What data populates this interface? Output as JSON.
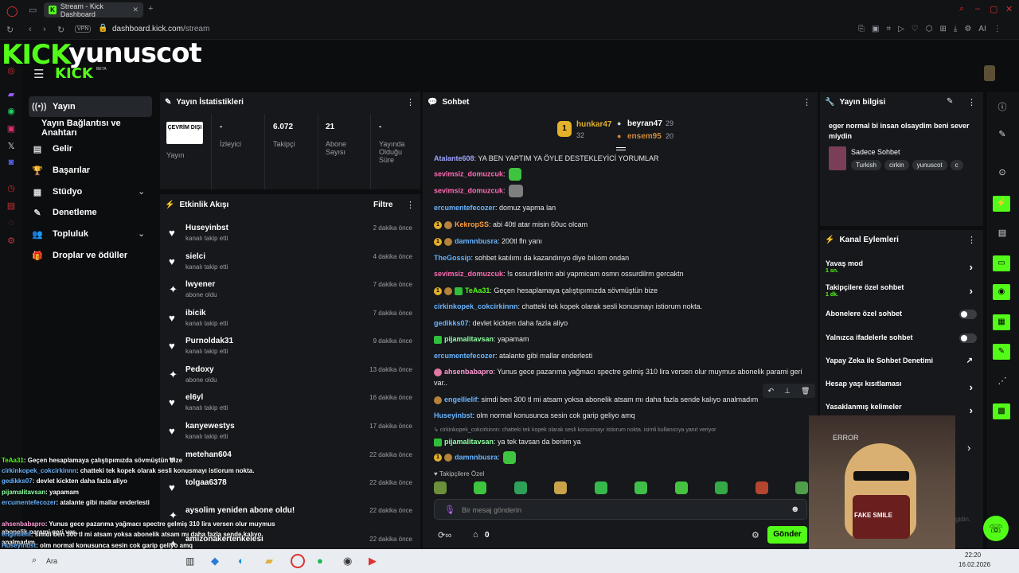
{
  "browser": {
    "tab_title": "Stream - Kick Dashboard",
    "url_domain": "dashboard.kick.com",
    "url_path": "/stream",
    "vpn": "VPN",
    "ai": "AI"
  },
  "brand": {
    "logo": "KICK",
    "channel": "yunuscot",
    "small_logo": "KICK",
    "beta": "BETA"
  },
  "nav": {
    "items": [
      {
        "label": "Yayın",
        "icon": "((•))"
      },
      {
        "label": "Yayın Bağlantısı ve Anahtarı"
      },
      {
        "label": "Gelir",
        "icon": "▤"
      },
      {
        "label": "Başarılar",
        "icon": "🏆"
      },
      {
        "label": "Stüdyo",
        "icon": "▦"
      },
      {
        "label": "Denetleme",
        "icon": "✎"
      },
      {
        "label": "Topluluk",
        "icon": "👥"
      },
      {
        "label": "Droplar ve ödüller",
        "icon": "🎁"
      }
    ]
  },
  "stats": {
    "title": "Yayın İstatistikleri",
    "badge": "ÇEVRİM DIŞI",
    "items": [
      {
        "value": "",
        "label": "Yayın"
      },
      {
        "value": "-",
        "label": "İzleyici"
      },
      {
        "value": "6.072",
        "label": "Takipçi"
      },
      {
        "value": "21",
        "label": "Abone Sayısı"
      },
      {
        "value": "-",
        "label": "Yayında Olduğu Süre"
      }
    ]
  },
  "activity": {
    "title": "Etkinlik Akışı",
    "filter": "Filtre",
    "rows": [
      {
        "name": "Huseyinbst",
        "sub": "kanalı takip etti",
        "time": "2 dakika önce",
        "icon": "♥"
      },
      {
        "name": "sielci",
        "sub": "kanalı takip etti",
        "time": "4 dakika önce",
        "icon": "♥"
      },
      {
        "name": "lwyener",
        "sub": "abone oldu",
        "time": "7 dakika önce",
        "icon": "✦"
      },
      {
        "name": "ibicik",
        "sub": "kanalı takip etti",
        "time": "7 dakika önce",
        "icon": "♥"
      },
      {
        "name": "Purnoldak31",
        "sub": "kanalı takip etti",
        "time": "9 dakika önce",
        "icon": "♥"
      },
      {
        "name": "Pedoxy",
        "sub": "abone oldu",
        "time": "13 dakika önce",
        "icon": "✦"
      },
      {
        "name": "el6yl",
        "sub": "kanalı takip etti",
        "time": "16 dakika önce",
        "icon": "♥"
      },
      {
        "name": "kanyewestys",
        "sub": "kanalı takip etti",
        "time": "17 dakika önce",
        "icon": "♥"
      },
      {
        "name": "metehan604",
        "sub": "",
        "time": "22 dakika önce",
        "icon": "♥"
      },
      {
        "name": "tolgaa6378",
        "sub": "",
        "time": "22 dakika önce",
        "icon": "♥"
      },
      {
        "name": "aysolim yeniden abone oldu!",
        "sub": "",
        "time": "22 dakika önce",
        "icon": "✦"
      },
      {
        "name": "amizonakertenkelesi",
        "sub": "",
        "time": "22 dakika önce",
        "icon": "✦"
      }
    ]
  },
  "chat": {
    "title": "Sohbet",
    "leaders": [
      {
        "rank": "1",
        "name": "hunkar47",
        "count": "32"
      },
      {
        "rank": "",
        "name": "beyran47",
        "count": "29"
      },
      {
        "rank": "",
        "name": "ensem95",
        "count": "20"
      }
    ],
    "messages": [
      {
        "user": "Atalante608",
        "color": "#9ea3ff",
        "text": ": YA BEN YAPTIM YA ÖYLE DESTEKLEYİCİ YORUMLAR",
        "badges": []
      },
      {
        "user": "sevimsiz_domuzcuk",
        "color": "#ff6bb5",
        "text": ":",
        "badges": [],
        "emote": "green"
      },
      {
        "user": "sevimsiz_domuzcuk",
        "color": "#ff6bb5",
        "text": ":",
        "badges": [],
        "emote": "gray"
      },
      {
        "user": "ercumentefecozer",
        "color": "#69b4ff",
        "text": ": domuz yapma lan",
        "badges": []
      },
      {
        "user": "KekropSS",
        "color": "#ff9a3c",
        "text": ": abi 40tl atar misin 60uc olcam",
        "badges": [
          "gold",
          "bronze"
        ]
      },
      {
        "user": "damnnbusra",
        "color": "#69b4ff",
        "text": ": 200tl fln yanı",
        "badges": [
          "gold",
          "bronze"
        ]
      },
      {
        "user": "TheGossip",
        "color": "#5fb0ff",
        "text": ": sohbet katılımı da kazandırıyo diye bılıom ondan",
        "badges": []
      },
      {
        "user": "sevimsiz_domuzcuk",
        "color": "#ff6bb5",
        "text": ": !s ossurdilerim abi yapmicam osmn ossurdilrm gercaktn",
        "badges": []
      },
      {
        "user": "TeAa31",
        "color": "#53fc18",
        "text": ": Geçen hesaplamaya çalıştıpımızda sövmüştün bize",
        "badges": [
          "gold",
          "bronze",
          "green"
        ]
      },
      {
        "user": "cirkinkopek_cokcirkinnn",
        "color": "#69b4ff",
        "text": ": chatteki tek kopek olarak sesli konusmayı istiorum nokta.",
        "badges": []
      },
      {
        "user": "gedikks07",
        "color": "#69b4ff",
        "text": ": devlet kickten daha fazla aliyo",
        "badges": []
      },
      {
        "user": "pijamalitavsan",
        "color": "#8effa0",
        "text": ": yapamam",
        "badges": [
          "green"
        ]
      },
      {
        "user": "ercumentefecozer",
        "color": "#69b4ff",
        "text": ": atalante gibi mallar enderlesti",
        "badges": []
      },
      {
        "user": "ahsenbabapro",
        "color": "#ff9ad5",
        "text": ": Yunus gece pazarıma yağmacı spectre gelmiş 310 lira versen olur muymus abonelik parami geri var..",
        "badges": [
          "pink"
        ]
      },
      {
        "user": "engellielif",
        "color": "#69b4ff",
        "text": ": simdi ben 300 tl mi atsam yoksa abonelik atsam mı daha fazla sende kalıyo analmadım",
        "badges": [
          "bronze"
        ]
      },
      {
        "user": "Huseyinbst",
        "color": "#69b4ff",
        "text": ": olm normal konusunca sesin cok garip geliyo amq",
        "badges": []
      },
      {
        "user": "pijamalitavsan",
        "color": "#8effa0",
        "text": ": ya tek tavsan da benim ya",
        "badges": [
          "green"
        ],
        "reply": "cirkinkopek_cokcirkinnn: chatteki tek kopek olarak sesli konusmayı istiorum nokta. isimli kullanıcıya yanıt veriyor"
      },
      {
        "user": "damnnbusra",
        "color": "#69b4ff",
        "text": ":",
        "badges": [
          "gold",
          "bronze"
        ],
        "emote": "green"
      }
    ],
    "followers_only": "Takipçilere Özel",
    "input_placeholder": "Bir mesaj gönderin",
    "points": "0",
    "send": "Gönder"
  },
  "info": {
    "title": "Yayın bilgisi",
    "stream_title": "eger normal bi insan olsaydim beni sever miydin",
    "category": "Sadece Sohbet",
    "tags": [
      "Turkish",
      "cirkin",
      "yunuscot",
      "c"
    ]
  },
  "channel_actions": {
    "title": "Kanal Eylemleri",
    "rows": [
      {
        "label": "Yavaş mod",
        "sub": "1 sn.",
        "type": "chevron"
      },
      {
        "label": "Takipçilere özel sohbet",
        "sub": "1 dk.",
        "type": "chevron"
      },
      {
        "label": "Abonelere özel sohbet",
        "sub": "",
        "type": "toggle"
      },
      {
        "label": "Yalnızca ifadelerle sohbet",
        "sub": "",
        "type": "toggle"
      },
      {
        "label": "Yapay Zeka ile Sohbet Denetimi",
        "sub": "",
        "type": "external"
      },
      {
        "label": "Hesap yaşı kısıtlaması",
        "sub": "",
        "type": "chevron"
      },
      {
        "label": "Yasaklanmış kelimeler",
        "sub": "",
        "type": "chevron"
      }
    ]
  },
  "overlay": {
    "partial_text": "gidin.",
    "error_text": "ERROR",
    "fake_smile": "FAKE SMILE",
    "lines": [
      {
        "user": "TeAa31",
        "text": ": Geçen hesaplamaya çalıştıpımızda sövmüştün bize",
        "color": "#53fc18"
      },
      {
        "user": "cirkinkopek_cokcirkinnn",
        "text": ": chatteki tek kopek olarak sesli konusmayı istiorum nokta.",
        "color": "#69b4ff"
      },
      {
        "user": "gedikks07",
        "text": ": devlet kickten daha fazla aliyo",
        "color": "#69b4ff"
      },
      {
        "user": "pijamalitavsan",
        "text": ": yapamam",
        "color": "#8effa0"
      },
      {
        "user": "ercumentefecozer",
        "text": ": atalante gibi mallar enderlesti",
        "color": "#69b4ff"
      },
      {
        "user": "ahsenbabapro",
        "text": ": Yunus gece pazarıma yağmacı spectre gelmiş 310 lira versen olur muymus abonelik parami geri var..",
        "color": "#ff9ad5"
      },
      {
        "user": "engellielif",
        "text": ": simdi ben 300 tl mi atsam yoksa abonelik atsam mı daha fazla sende kalıyo analmadım",
        "color": "#69b4ff"
      },
      {
        "user": "Huseyinbst",
        "text": ": olm normal konusunca sesin cok garip geliyo amq",
        "color": "#69b4ff"
      },
      {
        "user": "pijamalitavsan",
        "text": ": ya tek tavsan da benim ya",
        "color": "#8effa0"
      },
      {
        "user": "damnnbusra",
        "text": ":",
        "color": "#69b4ff"
      }
    ]
  },
  "taskbar": {
    "search": "Ara",
    "time": "22:20",
    "date": "16.02.2026"
  }
}
